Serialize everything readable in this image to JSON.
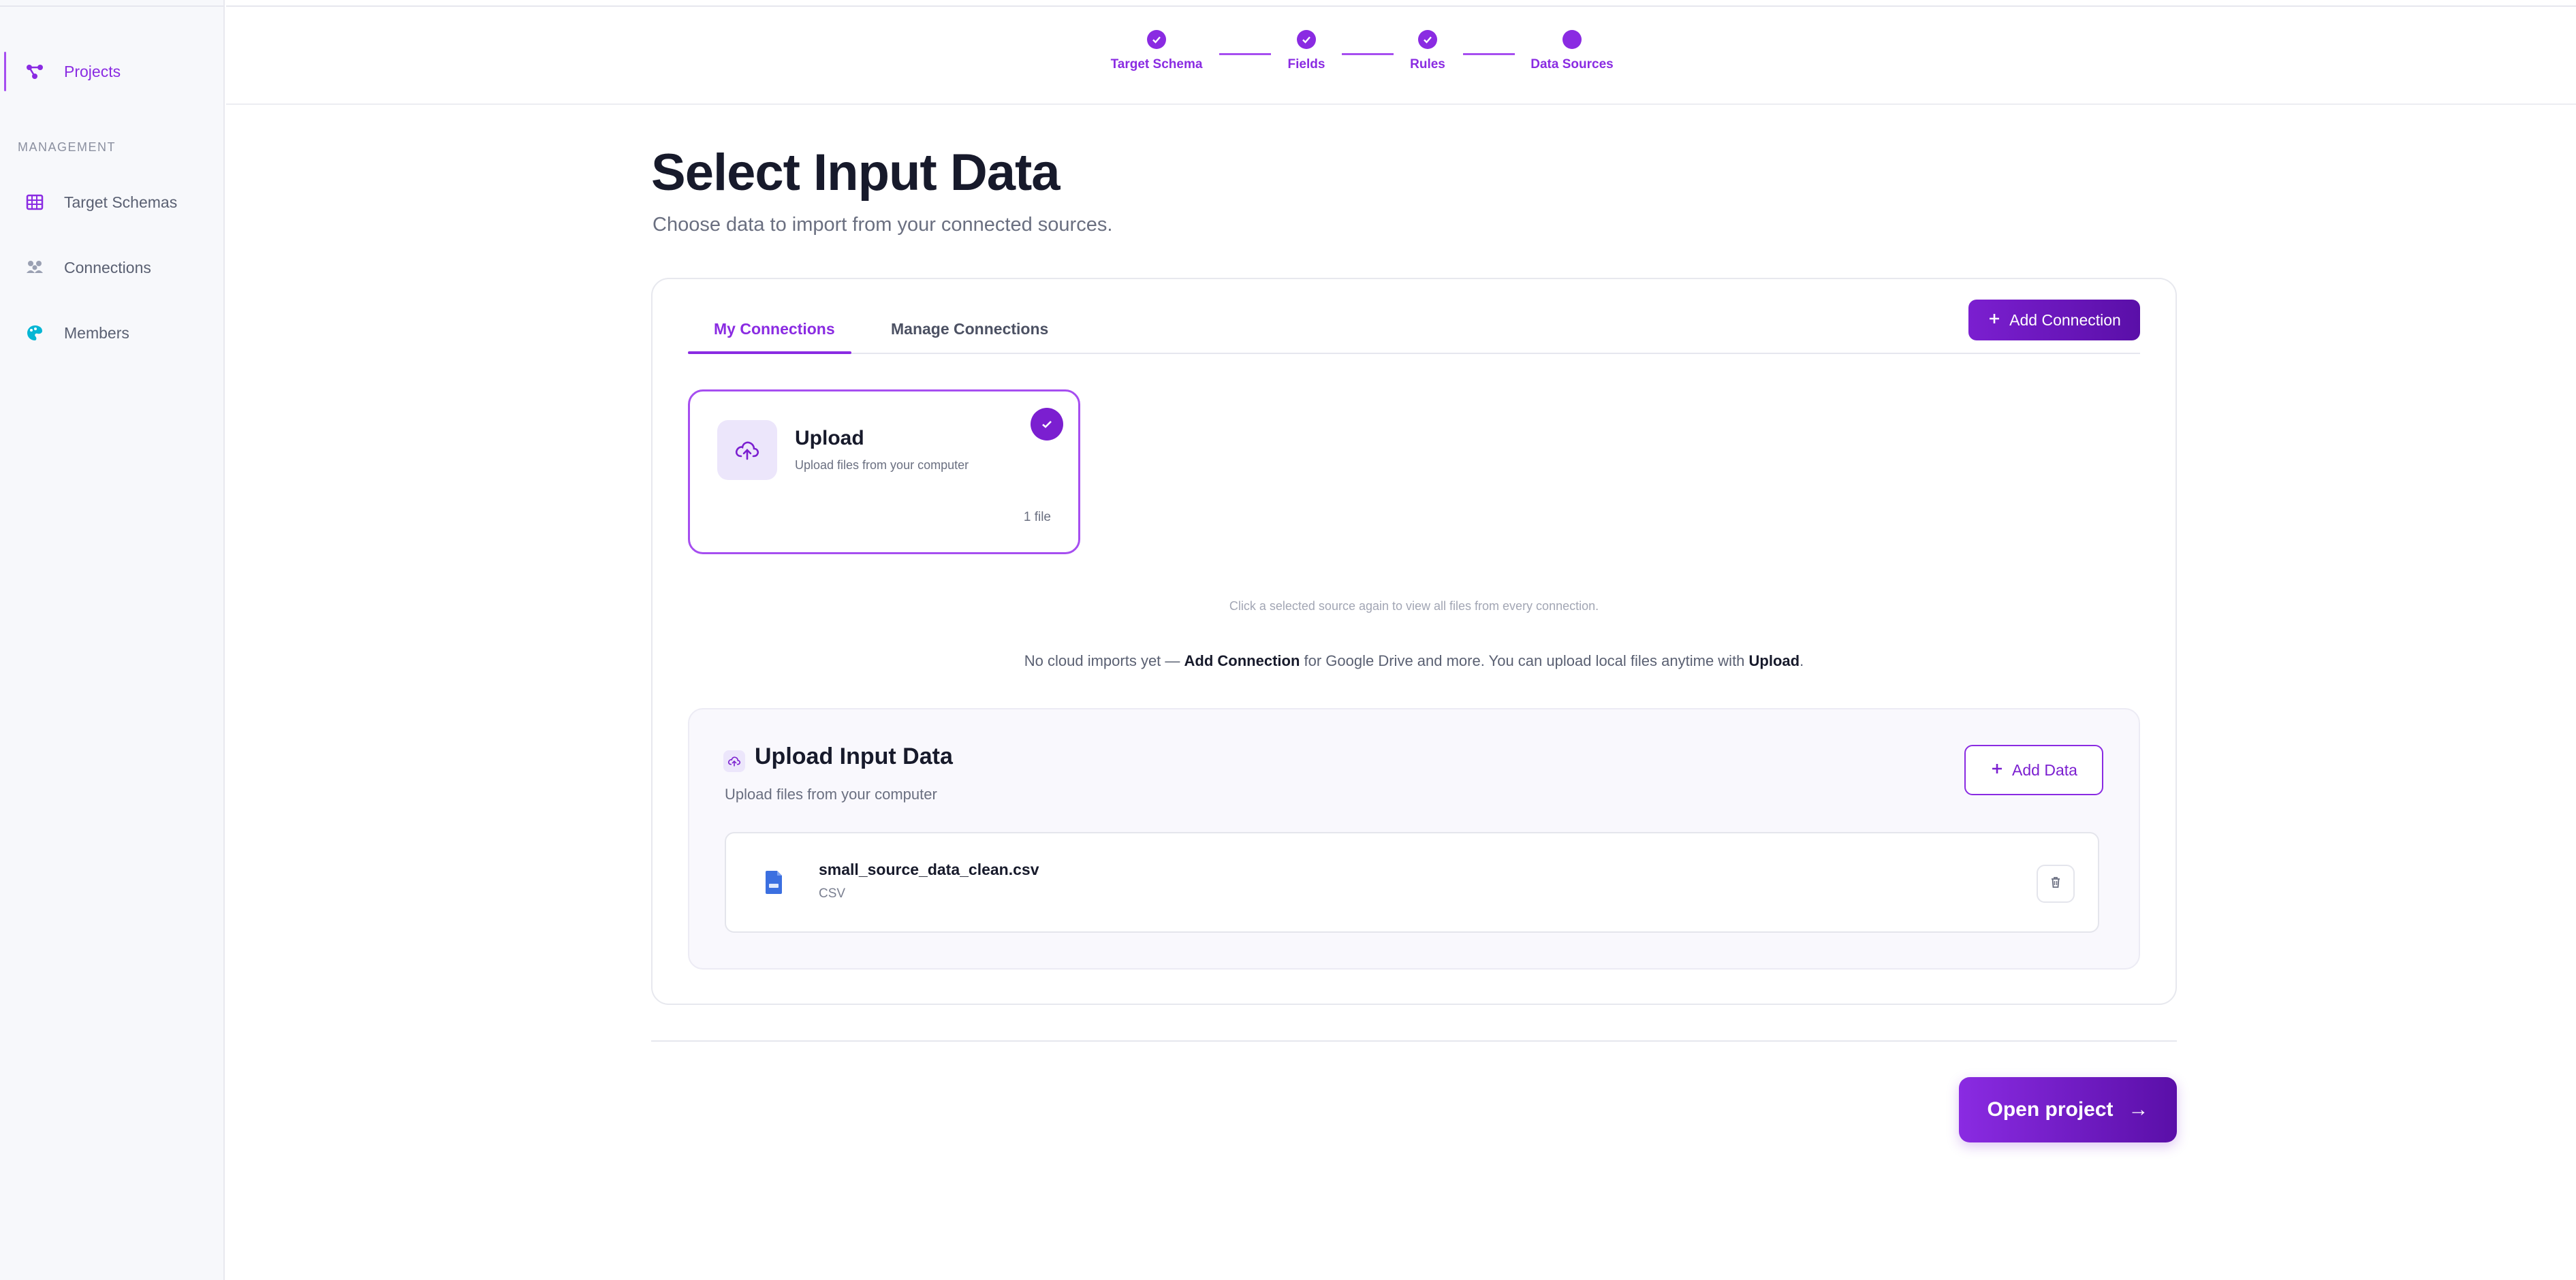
{
  "sidebar": {
    "items": [
      {
        "label": "Projects",
        "icon": "projects-icon",
        "active": true
      },
      {
        "label": "Target Schemas",
        "icon": "grid-icon"
      },
      {
        "label": "Connections",
        "icon": "people-icon"
      },
      {
        "label": "Members",
        "icon": "palette-icon"
      }
    ],
    "section_heading": "MANAGEMENT"
  },
  "stepper": {
    "steps": [
      {
        "label": "Target Schema",
        "state": "complete"
      },
      {
        "label": "Fields",
        "state": "complete"
      },
      {
        "label": "Rules",
        "state": "complete"
      },
      {
        "label": "Data Sources",
        "state": "current"
      }
    ]
  },
  "page": {
    "title": "Select Input Data",
    "subtitle": "Choose data to import from your connected sources."
  },
  "tabs": [
    {
      "label": "My Connections",
      "active": true
    },
    {
      "label": "Manage Connections",
      "active": false
    }
  ],
  "add_connection_button": {
    "label": "Add Connection"
  },
  "source_tile": {
    "title": "Upload",
    "subtitle": "Upload files from your computer",
    "count": "1 file",
    "selected": true
  },
  "hint": "Click a selected source again to view all files from every connection.",
  "info": {
    "prefix": "No cloud imports yet — ",
    "bold1": "Add Connection",
    "middle": " for Google Drive and more. You can upload local files anytime with ",
    "bold2": "Upload",
    "suffix": "."
  },
  "upload_panel": {
    "title": "Upload Input Data",
    "subtitle": "Upload files from your computer",
    "add_button": "Add Data",
    "files": [
      {
        "name": "small_source_data_clean.csv",
        "type": "CSV"
      }
    ]
  },
  "open_project_button": {
    "label": "Open project",
    "arrow": "→"
  },
  "colors": {
    "accent": "#8a2be2",
    "accent_dark": "#5a0fa8",
    "tile_bg": "#ece6fb",
    "file_icon": "#3b6fe0"
  }
}
